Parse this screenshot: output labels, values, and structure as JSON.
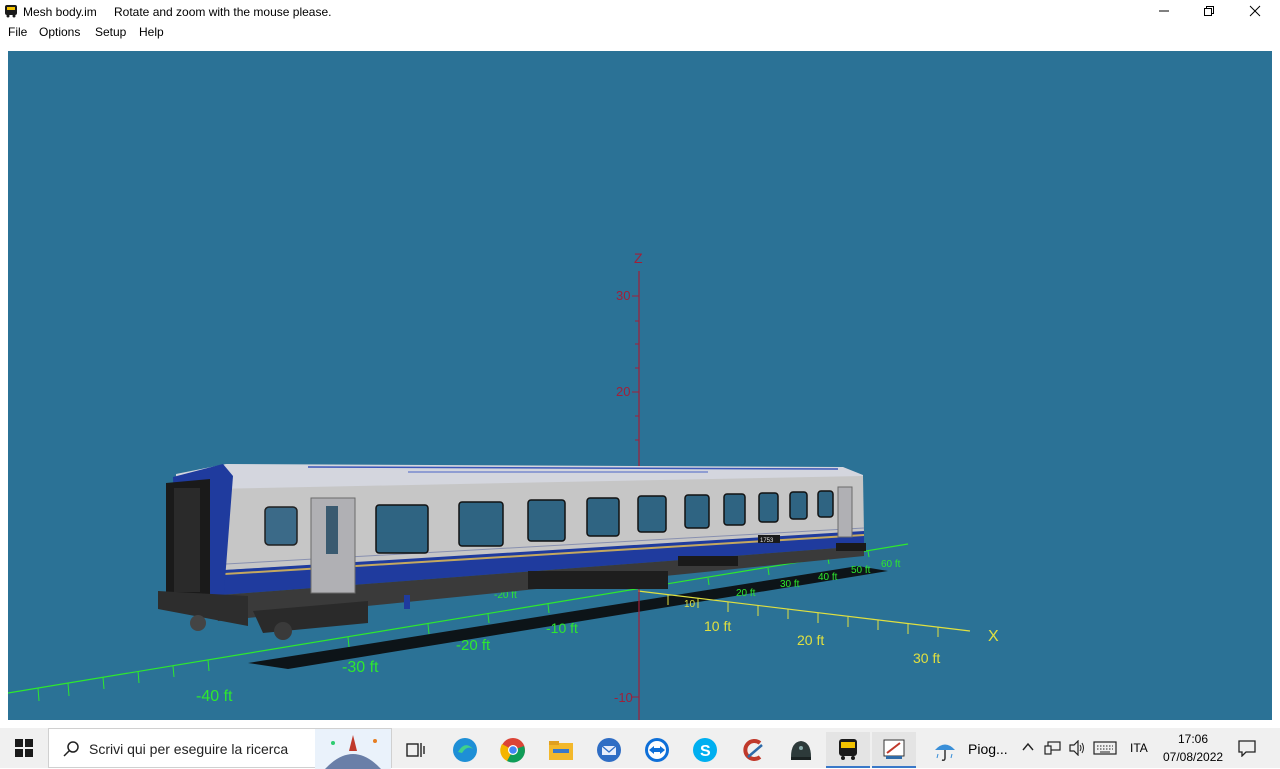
{
  "window": {
    "title": "Mesh body.im",
    "subtitle": "Rotate and zoom with the mouse please."
  },
  "menu": {
    "items": [
      "File",
      "Options",
      "Setup",
      "Help"
    ]
  },
  "viewport": {
    "background": "#2b7296",
    "axis_labels": {
      "z": "Z",
      "x": "X"
    },
    "z_ticks": [
      "30",
      "20",
      "-10"
    ],
    "x_ticks": [
      "10 ft",
      "20 ft",
      "30 ft"
    ],
    "y_ticks": [
      "-40 ft",
      "-30 ft",
      "-20 ft",
      "-10 ft"
    ],
    "far_ticks": [
      "-20 ft",
      "10",
      "20 ft",
      "30 ft",
      "40 ft",
      "50 ft",
      "60 ft"
    ],
    "model_badge": "1753"
  },
  "taskbar": {
    "search_placeholder": "Scrivi qui per eseguire la ricerca",
    "weather_text": "Piog...",
    "language": "ITA",
    "time": "17:06",
    "date": "07/08/2022"
  },
  "colors": {
    "axis_z": "#a0203a",
    "grid_green": "#2ee82e",
    "grid_yellow": "#e0e040",
    "car_blue": "#1f3b9e",
    "car_silver": "#c6c6c6"
  }
}
